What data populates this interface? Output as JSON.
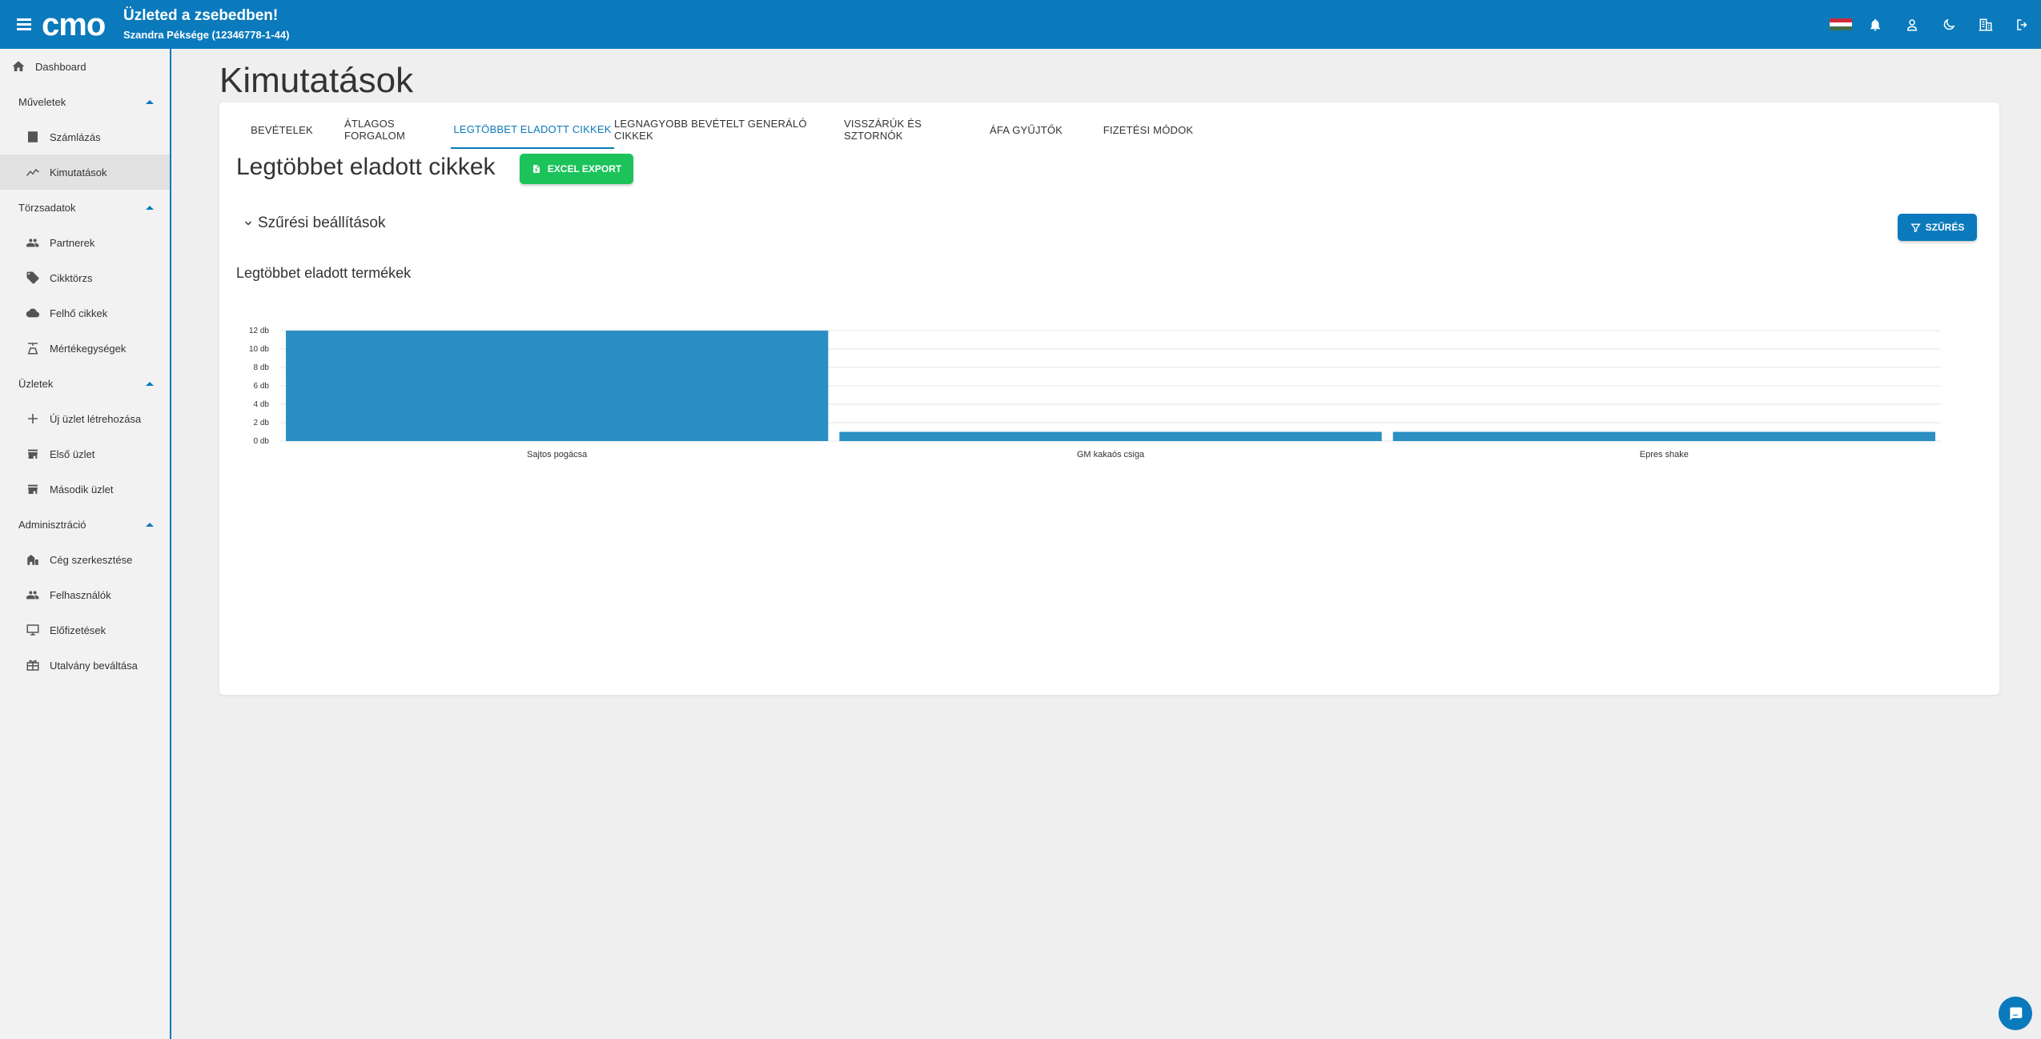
{
  "header": {
    "logo_text": "cmo",
    "store_title": "Üzleted a zsebedben!",
    "store_subtitle": "Szandra Péksége (12346778-1-44)",
    "icons": [
      "hungarian-flag",
      "bell-icon",
      "account-icon",
      "dark-mode-icon",
      "company-icon",
      "logout-icon"
    ],
    "brand_color": "#0a7abc"
  },
  "sidebar": {
    "dashboard": "Dashboard",
    "sections": [
      {
        "label": "Műveletek",
        "items": [
          {
            "label": "Számlázás",
            "icon": "receipt-icon"
          },
          {
            "label": "Kimutatások",
            "icon": "chart-line-icon",
            "active": true
          }
        ]
      },
      {
        "label": "Törzsadatok",
        "items": [
          {
            "label": "Partnerek",
            "icon": "people-icon"
          },
          {
            "label": "Cikktörzs",
            "icon": "tag-icon"
          },
          {
            "label": "Felhő cikkek",
            "icon": "cloud-icon"
          },
          {
            "label": "Mértékegységek",
            "icon": "scale-icon"
          }
        ]
      },
      {
        "label": "Üzletek",
        "items": [
          {
            "label": "Új üzlet létrehozása",
            "icon": "plus-icon"
          },
          {
            "label": "Első üzlet",
            "icon": "store-icon"
          },
          {
            "label": "Második üzlet",
            "icon": "store-icon"
          }
        ]
      },
      {
        "label": "Adminisztráció",
        "items": [
          {
            "label": "Cég szerkesztése",
            "icon": "company-edit-icon"
          },
          {
            "label": "Felhasználók",
            "icon": "people-icon"
          },
          {
            "label": "Előfizetések",
            "icon": "subscription-icon"
          },
          {
            "label": "Utalvány beváltása",
            "icon": "voucher-icon"
          }
        ]
      }
    ]
  },
  "main": {
    "page_title": "Kimutatások",
    "tabs": [
      {
        "label": "Bevételek"
      },
      {
        "label": "Átlagos forgalom"
      },
      {
        "label": "Legtöbbet eladott cikkek",
        "active": true
      },
      {
        "label": "Legnagyobb bevételt generáló cikkek"
      },
      {
        "label": "Visszárúk és sztornók"
      },
      {
        "label": "Áfa gyűjtők"
      },
      {
        "label": "Fizetési módok"
      }
    ],
    "section_title": "Legtöbbet eladott cikkek",
    "excel_export_label": "EXCEL EXPORT",
    "filter_settings_label": "Szűrési beállítások",
    "filter_button_label": "SZŰRÉS"
  },
  "chart_data": {
    "type": "bar",
    "title": "Legtöbbet eladott termékek",
    "categories": [
      "Sajtos pogácsa",
      "GM kakaós csiga",
      "Epres shake"
    ],
    "values": [
      12,
      1,
      1
    ],
    "unit": "db",
    "ylim": [
      0,
      12
    ],
    "yticks": [
      0,
      2,
      4,
      6,
      8,
      10,
      12
    ],
    "ytick_labels": [
      "0 db",
      "2 db",
      "4 db",
      "6 db",
      "8 db",
      "10 db",
      "12 db"
    ],
    "bar_color": "#2b8fc4",
    "grid": true
  }
}
